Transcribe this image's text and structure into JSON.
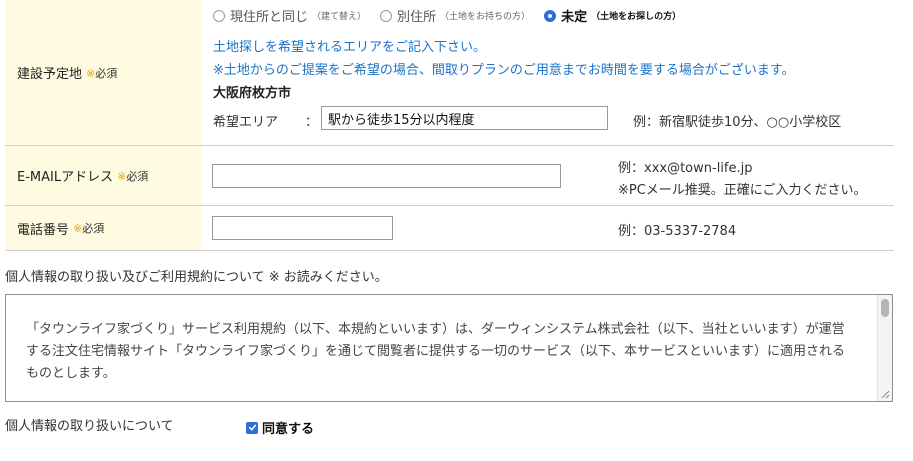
{
  "location": {
    "label": "建設予定地",
    "required_mark": "※",
    "required_text": "必須",
    "options": [
      {
        "label": "現住所と同じ",
        "note": "（建て替え）",
        "selected": false
      },
      {
        "label": "別住所",
        "note": "（土地をお持ちの方）",
        "selected": false
      },
      {
        "label": "未定",
        "note": "（土地をお探しの方）",
        "selected": true
      }
    ],
    "info_line1": "土地探しを希望されるエリアをご記入下さい。",
    "info_line2": "※土地からのご提案をご希望の場合、間取りプランのご用意までお時間を要する場合がございます。",
    "city": "大阪府枚方市",
    "area_label": "希望エリア",
    "area_colon": "：",
    "area_value": "駅から徒歩15分以内程度",
    "area_example": "例：新宿駅徒歩10分、○○小学校区"
  },
  "email": {
    "label": "E-MAILアドレス",
    "required_mark": "※",
    "required_text": "必須",
    "value": "",
    "example1": "例：xxx@town-life.jp",
    "example2": "※PCメール推奨。正確にご入力ください。"
  },
  "phone": {
    "label": "電話番号",
    "required_mark": "※",
    "required_text": "必須",
    "value": "",
    "example": "例：03-5337-2784"
  },
  "privacy": {
    "heading": "個人情報の取り扱い及びご利用規約について ※ お読みください。",
    "terms": "「タウンライフ家づくり」サービス利用規約（以下、本規約といいます）は、ダーウィンシステム株式会社（以下、当社といいます）が運営する注文住宅情報サイト「タウンライフ家づくり」を通じて閲覧者に提供する一切のサービス（以下、本サービスといいます）に適用されるものとします。",
    "agree_label": "個人情報の取り扱いについて",
    "agree_text": "同意する",
    "agreed": true
  },
  "colors": {
    "label_bg": "#fffbe0",
    "accent_blue": "#1a73c9",
    "radio_blue": "#2b6fdc",
    "required_orange": "#e6a100"
  }
}
